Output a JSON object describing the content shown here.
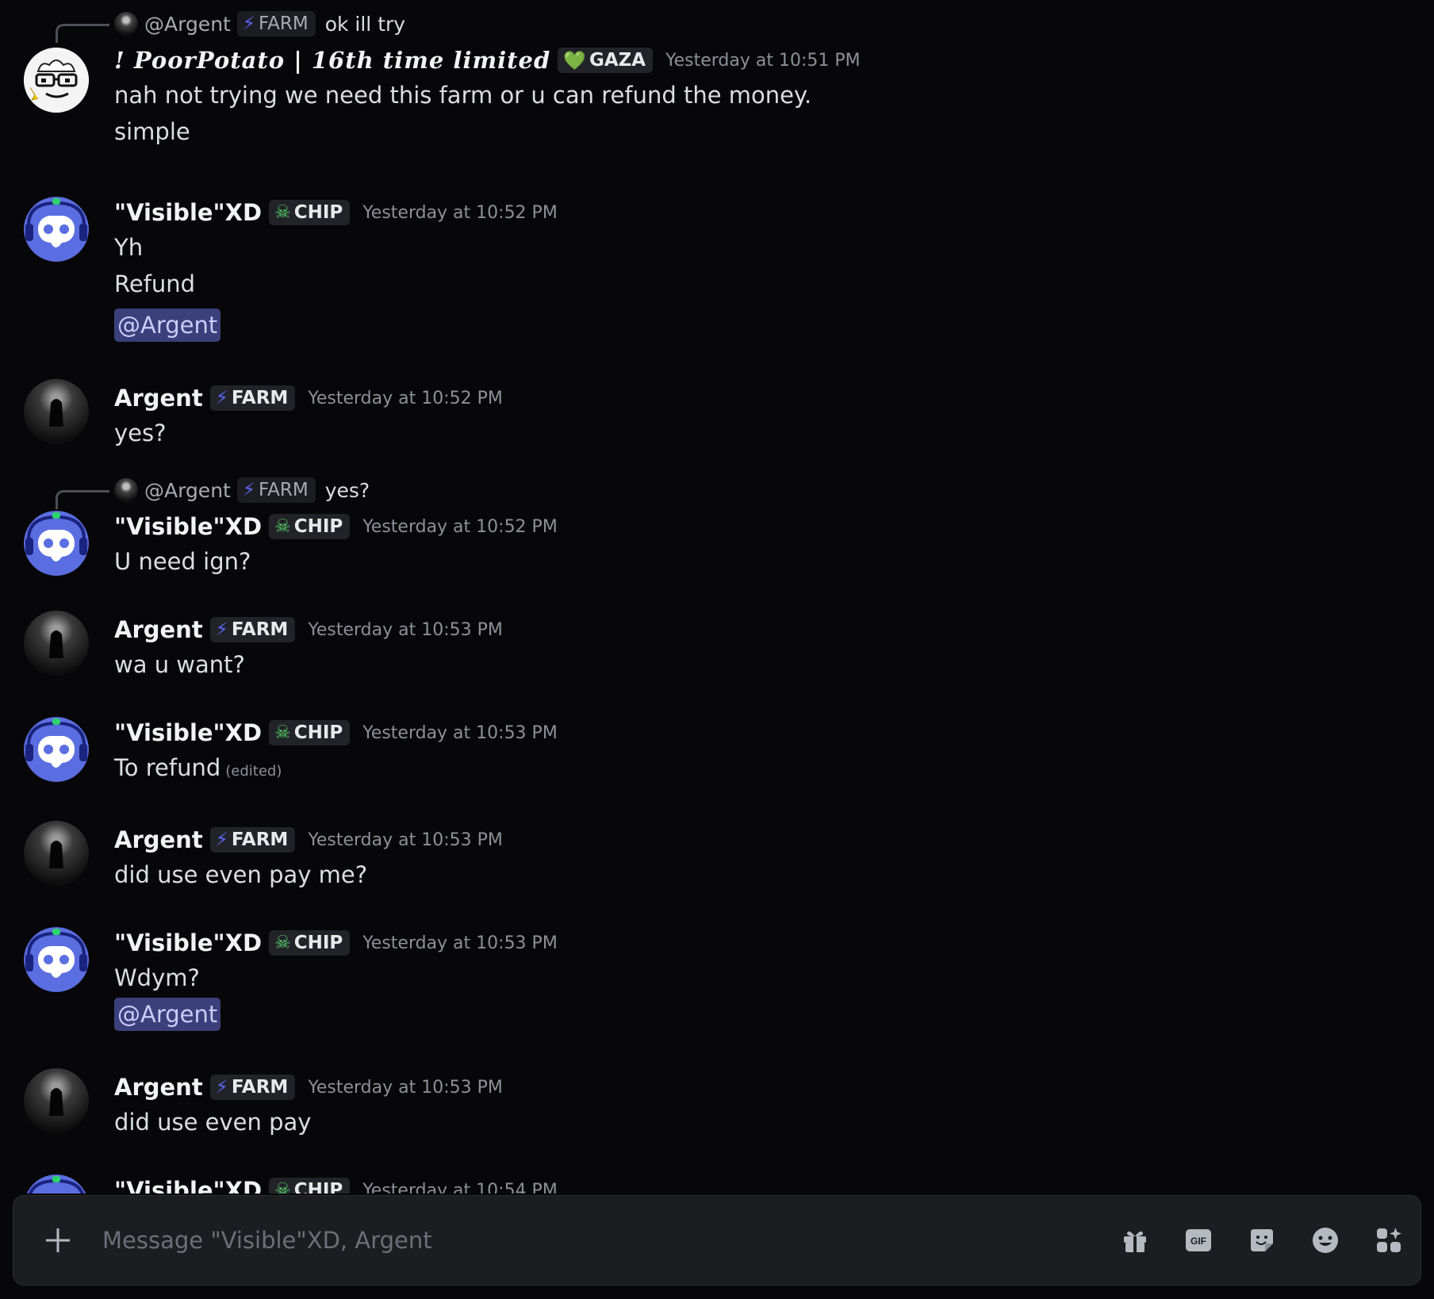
{
  "composer": {
    "placeholder": "Message \"Visible\"XD, Argent"
  },
  "messages": [
    {
      "reply": {
        "name": "@Argent",
        "tag": "FARM",
        "text": "ok ill try"
      },
      "author": "! PoorPotato | 16th time limited",
      "tag": "GAZA",
      "timestamp": "Yesterday at 10:51 PM",
      "lines": [
        "nah not trying we need this farm or u can refund the money.",
        "simple"
      ]
    },
    {
      "author": "\"Visible\"XD",
      "tag": "CHIP",
      "timestamp": "Yesterday at 10:52 PM",
      "lines": [
        "Yh",
        "Refund"
      ],
      "mention": "@Argent"
    },
    {
      "author": "Argent",
      "tag": "FARM",
      "timestamp": "Yesterday at 10:52 PM",
      "lines": [
        "yes?"
      ]
    },
    {
      "reply": {
        "name": "@Argent",
        "tag": "FARM",
        "text": "yes?"
      },
      "author": "\"Visible\"XD",
      "tag": "CHIP",
      "timestamp": "Yesterday at 10:52 PM",
      "lines": [
        "U need ign?"
      ]
    },
    {
      "author": "Argent",
      "tag": "FARM",
      "timestamp": "Yesterday at 10:53 PM",
      "lines": [
        "wa u  want?"
      ]
    },
    {
      "author": "\"Visible\"XD",
      "tag": "CHIP",
      "timestamp": "Yesterday at 10:53 PM",
      "lines": [
        "To refund"
      ],
      "edited": "(edited)"
    },
    {
      "author": "Argent",
      "tag": "FARM",
      "timestamp": "Yesterday at 10:53 PM",
      "lines": [
        "did use even pay me?"
      ]
    },
    {
      "author": "\"Visible\"XD",
      "tag": "CHIP",
      "timestamp": "Yesterday at 10:53 PM",
      "lines": [
        "Wdym?"
      ],
      "mention": "@Argent"
    },
    {
      "author": "Argent",
      "tag": "FARM",
      "timestamp": "Yesterday at 10:53 PM",
      "lines": [
        "did use  even pay"
      ]
    },
    {
      "author": "\"Visible\"XD",
      "tag": "CHIP",
      "timestamp": "Yesterday at 10:54 PM",
      "lines": []
    }
  ]
}
